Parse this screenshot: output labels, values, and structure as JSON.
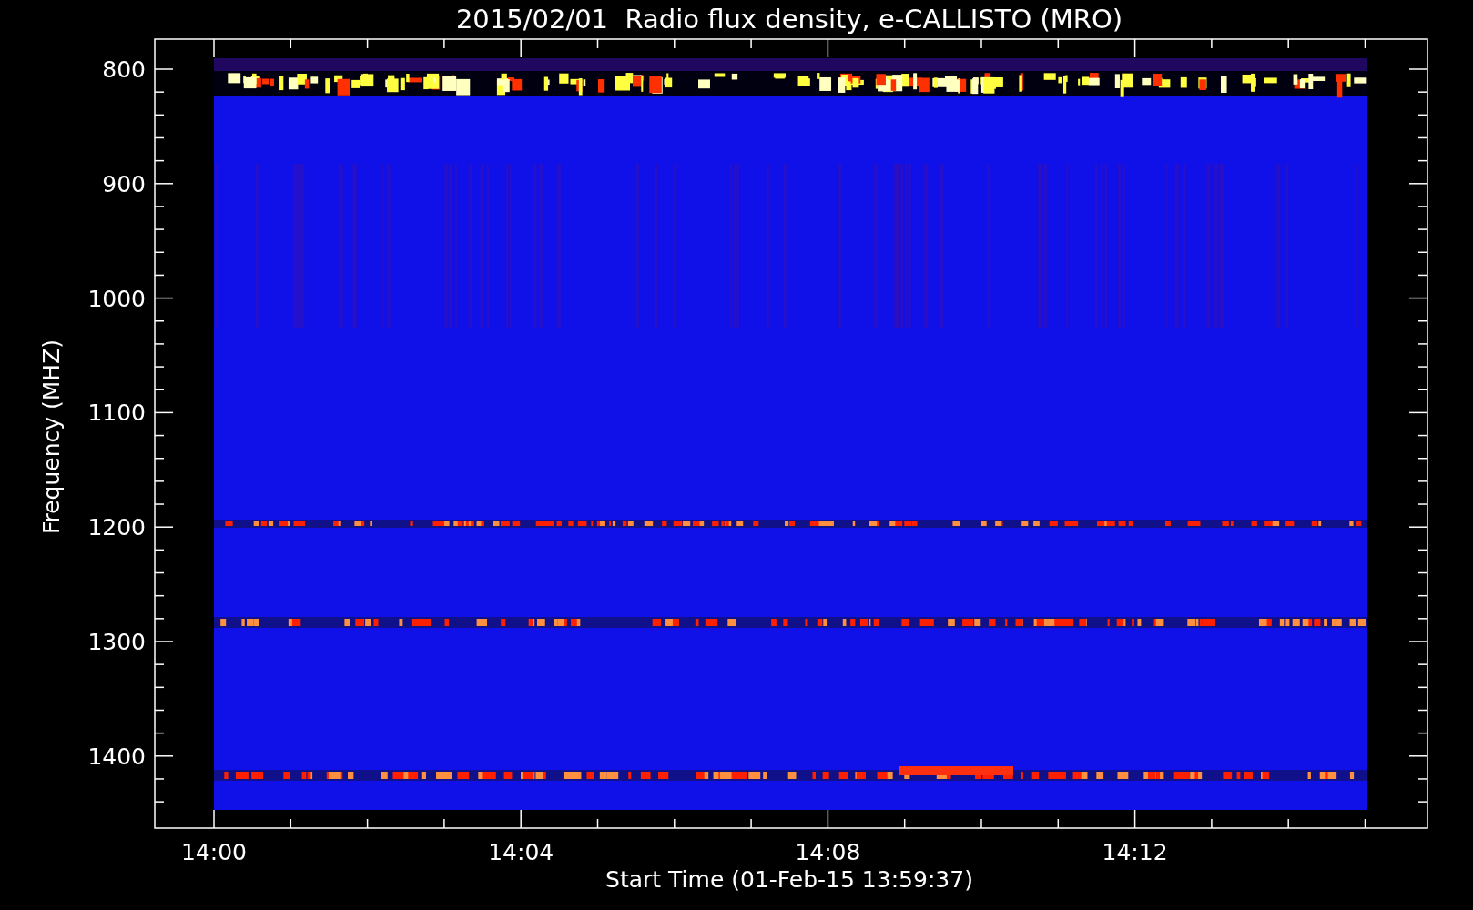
{
  "title": "2015/02/01  Radio flux density, e-CALLISTO (MRO)",
  "y_axis": {
    "label": "Frequency (MHZ)",
    "ticks": [
      "800",
      "900",
      "1000",
      "1100",
      "1200",
      "1300",
      "1400"
    ]
  },
  "x_axis": {
    "label": "Start Time (01-Feb-15 13:59:37)",
    "ticks": [
      "14:00",
      "14:04",
      "14:08",
      "14:12"
    ]
  }
}
